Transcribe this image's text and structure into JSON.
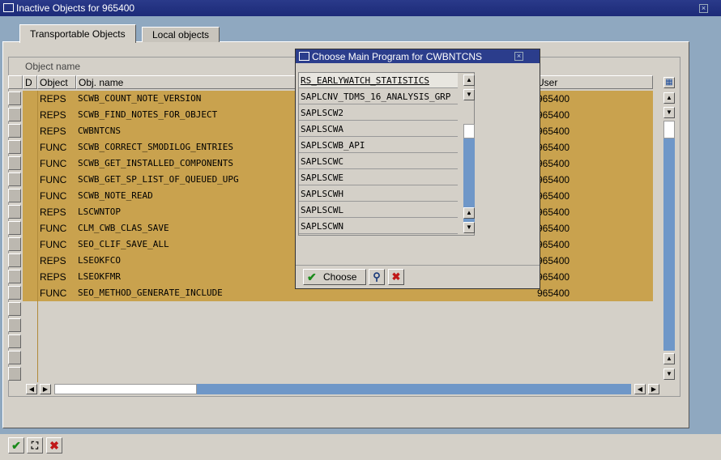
{
  "window": {
    "title": "Inactive Objects for 965400"
  },
  "tabs": [
    {
      "label": "Transportable Objects"
    },
    {
      "label": "Local objects"
    }
  ],
  "table": {
    "group_header": "Object name",
    "columns": {
      "d": "D",
      "object": "Object",
      "obj_name": "Obj. name",
      "user": "User"
    },
    "rows": [
      {
        "object": "REPS",
        "name": "SCWB_COUNT_NOTE_VERSION",
        "user": "965400"
      },
      {
        "object": "REPS",
        "name": "SCWB_FIND_NOTES_FOR_OBJECT",
        "user": "965400"
      },
      {
        "object": "REPS",
        "name": "CWBNTCNS",
        "user": "965400"
      },
      {
        "object": "FUNC",
        "name": "SCWB_CORRECT_SMODILOG_ENTRIES",
        "user": "965400"
      },
      {
        "object": "FUNC",
        "name": "SCWB_GET_INSTALLED_COMPONENTS",
        "user": "965400"
      },
      {
        "object": "FUNC",
        "name": "SCWB_GET_SP_LIST_OF_QUEUED_UPG",
        "user": "965400"
      },
      {
        "object": "FUNC",
        "name": "SCWB_NOTE_READ",
        "user": "965400"
      },
      {
        "object": "REPS",
        "name": "LSCWNTOP",
        "user": "965400"
      },
      {
        "object": "FUNC",
        "name": "CLM_CWB_CLAS_SAVE",
        "user": "965400"
      },
      {
        "object": "FUNC",
        "name": "SEO_CLIF_SAVE_ALL",
        "user": "965400"
      },
      {
        "object": "REPS",
        "name": "LSEOKFCO",
        "user": "965400"
      },
      {
        "object": "REPS",
        "name": "LSEOKFMR",
        "user": "965400"
      },
      {
        "object": "FUNC",
        "name": "SEO_METHOD_GENERATE_INCLUDE",
        "user": "965400"
      }
    ]
  },
  "popup": {
    "title": "Choose Main Program for CWBNTCNS",
    "items": [
      "RS_EARLYWATCH_STATISTICS",
      "SAPLCNV_TDMS_16_ANALYSIS_GRP",
      "SAPLSCW2",
      "SAPLSCWA",
      "SAPLSCWB_API",
      "SAPLSCWC",
      "SAPLSCWE",
      "SAPLSCWH",
      "SAPLSCWL",
      "SAPLSCWN"
    ],
    "choose_label": "Choose"
  },
  "icons": {
    "choose": "checkmark-icon",
    "find": "binoculars-icon",
    "cancel": "cancel-icon",
    "layout": "column-layout-icon"
  },
  "colors": {
    "row_highlight": "#c9a24e",
    "title_bar": "#1c2a78",
    "scroll_track": "#6f97c8"
  }
}
